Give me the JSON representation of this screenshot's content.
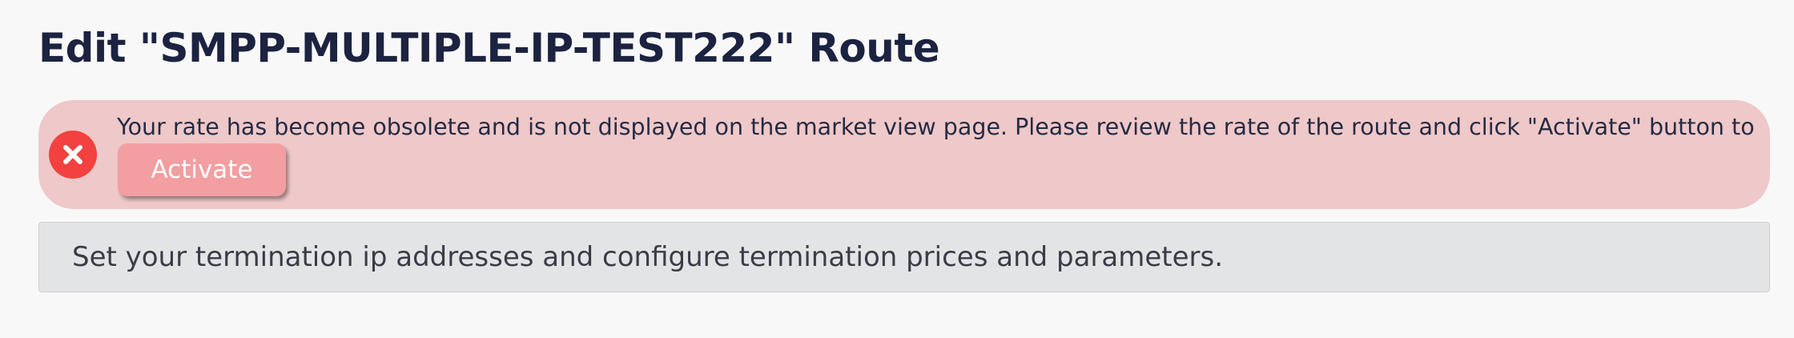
{
  "page": {
    "title": "Edit \"SMPP-MULTIPLE-IP-TEST222\" Route"
  },
  "alert": {
    "type": "error",
    "icon": "error-circle-x-icon",
    "message": "Your rate has become obsolete and is not displayed on the market view page. Please review the rate of the route and click \"Activate\" button to reactivate the route.",
    "button_label": "Activate",
    "colors": {
      "background": "#efc8c9",
      "icon": "#f2413e",
      "button": "#f39ea0"
    }
  },
  "info": {
    "text": "Set your termination ip addresses and configure termination prices and parameters."
  }
}
